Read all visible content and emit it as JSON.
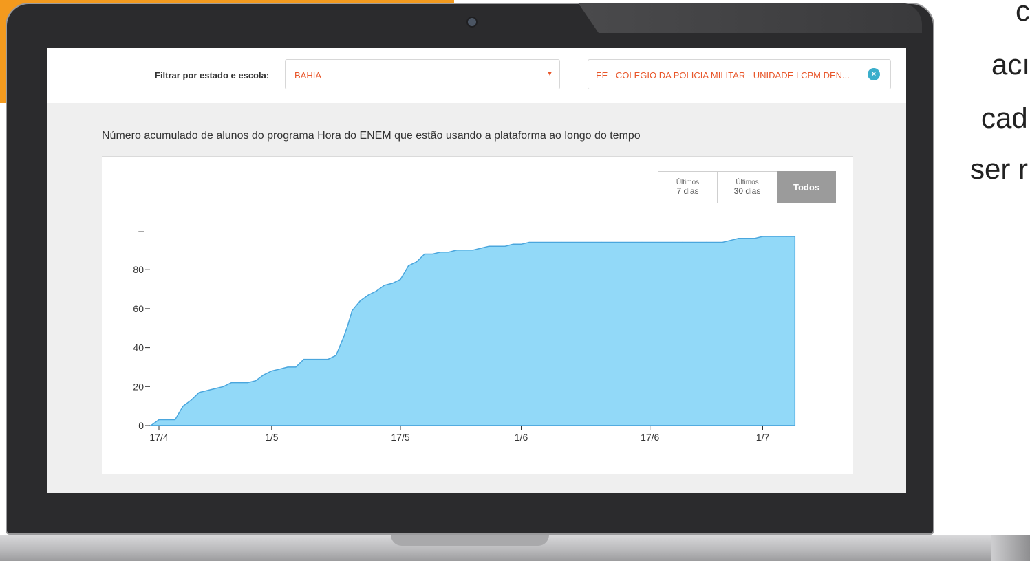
{
  "filter": {
    "label": "Filtrar por estado e escola:",
    "state_value": "BAHIA",
    "school_value": "EE - COLEGIO DA POLICIA MILITAR - UNIDADE I CPM DEN...",
    "clear_icon": "close-circle-icon"
  },
  "chart_title": "Número acumulado de alunos do programa Hora do ENEM que estão usando a plataforma ao longo do tempo",
  "range_buttons": [
    {
      "line1": "Últimos",
      "line2": "7 dias"
    },
    {
      "line1": "Últimos",
      "line2": "30 dias"
    },
    {
      "line1": "Todos",
      "line2": ""
    }
  ],
  "side_text": [
    "c",
    "acı",
    "cad",
    "ser r"
  ],
  "colors": {
    "accent": "#e8562a",
    "area_fill": "#92d9f8",
    "area_line": "#4aa6dd",
    "clear_button": "#3aaecb",
    "active_button": "#9b9b9b"
  },
  "chart_data": {
    "type": "area",
    "x_tick_labels": [
      "17/4",
      "1/5",
      "17/5",
      "1/6",
      "17/6",
      "1/7"
    ],
    "x_tick_days": [
      0,
      14,
      30,
      45,
      61,
      75
    ],
    "y_tick_labels": [
      "0",
      "20",
      "40",
      "60",
      "80",
      "–"
    ],
    "y_tick_values": [
      0,
      20,
      40,
      60,
      80,
      100
    ],
    "ylim": [
      0,
      100
    ],
    "x": [
      -1,
      0,
      2,
      3,
      4,
      5,
      6,
      7,
      8,
      9,
      10,
      11,
      12,
      13,
      14,
      15,
      16,
      17,
      18,
      19,
      20,
      21,
      22,
      23,
      23.5,
      24,
      25,
      26,
      27,
      28,
      29,
      30,
      31,
      32,
      33,
      34,
      35,
      36,
      37,
      38,
      39,
      40,
      41,
      42,
      43,
      44,
      45,
      46,
      50,
      55,
      60,
      65,
      68,
      70,
      71,
      72,
      73,
      74,
      75,
      76,
      77,
      78,
      79
    ],
    "values": [
      0,
      3,
      3,
      10,
      13,
      17,
      18,
      19,
      20,
      22,
      22,
      22,
      23,
      26,
      28,
      29,
      30,
      30,
      34,
      34,
      34,
      34,
      36,
      46,
      52,
      59,
      64,
      67,
      69,
      72,
      73,
      75,
      82,
      84,
      88,
      88,
      89,
      89,
      90,
      90,
      90,
      91,
      92,
      92,
      92,
      93,
      93,
      94,
      94,
      94,
      94,
      94,
      94,
      94,
      95,
      96,
      96,
      96,
      97,
      97,
      97,
      97,
      97,
      98
    ]
  }
}
